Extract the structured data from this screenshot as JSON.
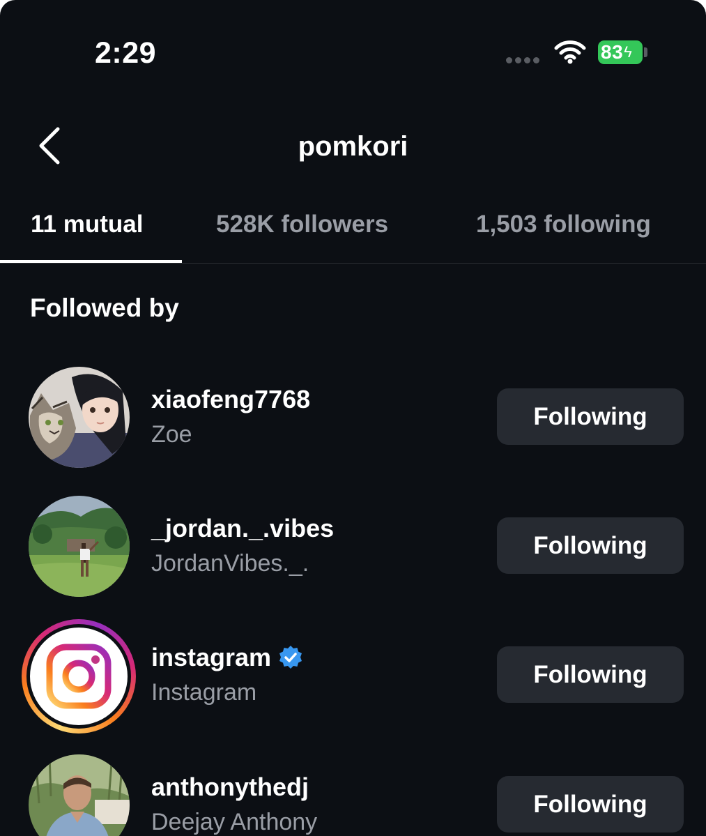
{
  "status_bar": {
    "time": "2:29",
    "battery": "83"
  },
  "header": {
    "title": "pomkori"
  },
  "tabs": [
    {
      "label": "11 mutual",
      "active": true
    },
    {
      "label": "528K followers",
      "active": false
    },
    {
      "label": "1,503 following",
      "active": false
    }
  ],
  "section_heading": "Followed by",
  "users": [
    {
      "username": "xiaofeng7768",
      "full_name": "Zoe",
      "verified": false,
      "button_label": "Following"
    },
    {
      "username": "_jordan._.vibes",
      "full_name": "JordanVibes._.",
      "verified": false,
      "button_label": "Following"
    },
    {
      "username": "instagram",
      "full_name": "Instagram",
      "verified": true,
      "button_label": "Following"
    },
    {
      "username": "anthonythedj",
      "full_name": "Deejay Anthony",
      "verified": false,
      "button_label": "Following"
    }
  ],
  "colors": {
    "background": "#0c0f14",
    "button_bg": "#262a31",
    "secondary_text": "#9a9ea6",
    "battery_green": "#34c759",
    "verified_blue": "#3897f0"
  }
}
